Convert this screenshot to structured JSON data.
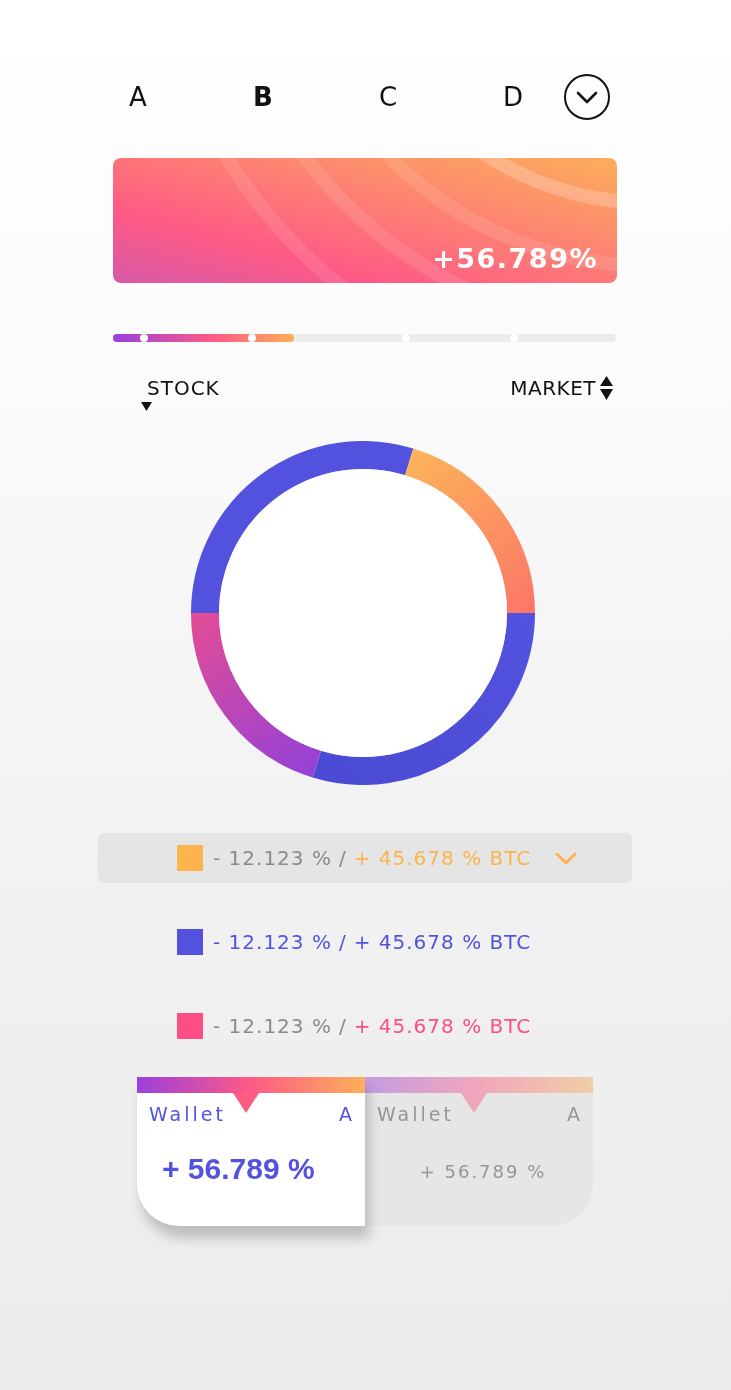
{
  "tabs": [
    {
      "label": "A",
      "selected": false
    },
    {
      "label": "B",
      "selected": true
    },
    {
      "label": "C",
      "selected": false
    },
    {
      "label": "D",
      "selected": false
    }
  ],
  "banner": {
    "value": "+56.789%"
  },
  "progress": {
    "level": 0.36
  },
  "sort": {
    "left_label": "STOCK",
    "right_label": "MARKET"
  },
  "legend": [
    {
      "color": "#fdb34e",
      "change": "- 12.123 %",
      "separator": "/",
      "value": "+ 45.678 % BTC",
      "selected": true,
      "highlight_change": false
    },
    {
      "color": "#5352df",
      "change": "- 12.123 %",
      "separator": "/",
      "value": "+ 45.678 % BTC",
      "selected": false,
      "highlight_change": true
    },
    {
      "color": "#fc4e85",
      "change": "- 12.123 %",
      "separator": "/",
      "value": "+ 45.678 % BTC",
      "selected": false,
      "highlight_change": false
    }
  ],
  "wallets": [
    {
      "label": "Wallet",
      "letter": "A",
      "value": "+ 56.789 %",
      "selected": true
    },
    {
      "label": "Wallet",
      "letter": "A",
      "value": "+ 56.789 %",
      "selected": false
    }
  ]
}
